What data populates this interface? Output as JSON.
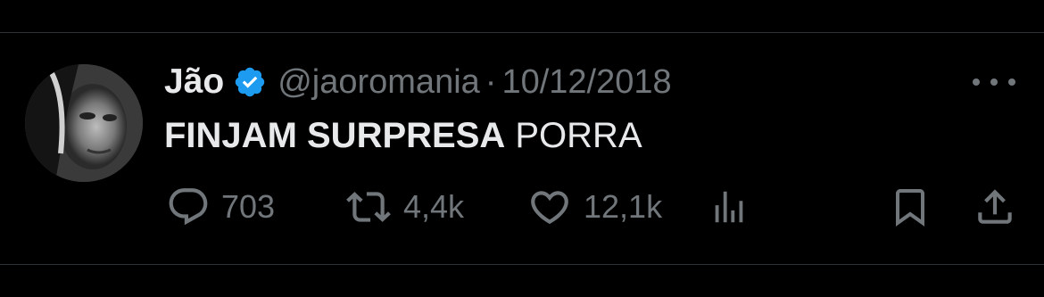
{
  "tweet": {
    "author_name": "Jão",
    "handle": "@jaoromania",
    "separator": "·",
    "date": "10/12/2018",
    "text_bold": "FINJAM SURPRESA",
    "text_rest": " PORRA",
    "verified": true
  },
  "actions": {
    "replies": "703",
    "retweets": "4,4k",
    "likes": "12,1k"
  },
  "icons": {
    "reply": "reply-icon",
    "retweet": "retweet-icon",
    "like": "heart-icon",
    "views": "views-chart-icon",
    "bookmark": "bookmark-icon",
    "share": "share-icon",
    "more": "more-icon",
    "verified": "verified-badge-icon"
  },
  "colors": {
    "background": "#000000",
    "text": "#e7e9ea",
    "muted": "#71767b",
    "verified": "#1d9bf0",
    "divider": "#2f3336"
  }
}
